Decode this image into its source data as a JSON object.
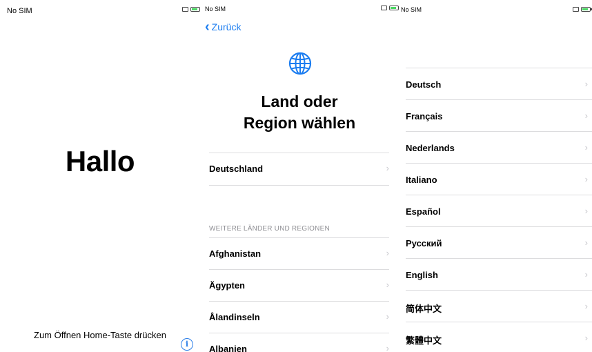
{
  "panels": {
    "hello": {
      "carrier": "No SIM",
      "greeting": "Hallo",
      "home_hint": "Zum Öffnen Home-Taste drücken",
      "info_glyph": "i"
    },
    "region": {
      "carrier": "No SIM",
      "back_label": "Zurück",
      "title_line1": "Land oder",
      "title_line2": "Region wählen",
      "suggested": "Deutschland",
      "section_header": "WEITERE LÄNDER UND REGIONEN",
      "countries": [
        "Afghanistan",
        "Ägypten",
        "Ålandinseln",
        "Albanien"
      ]
    },
    "language": {
      "carrier": "No SIM",
      "languages": [
        "Deutsch",
        "Français",
        "Nederlands",
        "Italiano",
        "Español",
        "Русский",
        "English",
        "简体中文",
        "繁體中文"
      ]
    }
  },
  "icons": {
    "globe": "globe-icon",
    "back": "chevron-left-icon",
    "row": "chevron-right-icon",
    "info": "info-icon",
    "battery": "battery-charging-icon",
    "screen": "screen-mirroring-icon"
  },
  "colors": {
    "accent_blue": "#1a7cf0",
    "separator": "#dcdcde",
    "chevron": "#c7c7cc",
    "section_header": "#8e8e93",
    "battery_green": "#4cd964"
  }
}
